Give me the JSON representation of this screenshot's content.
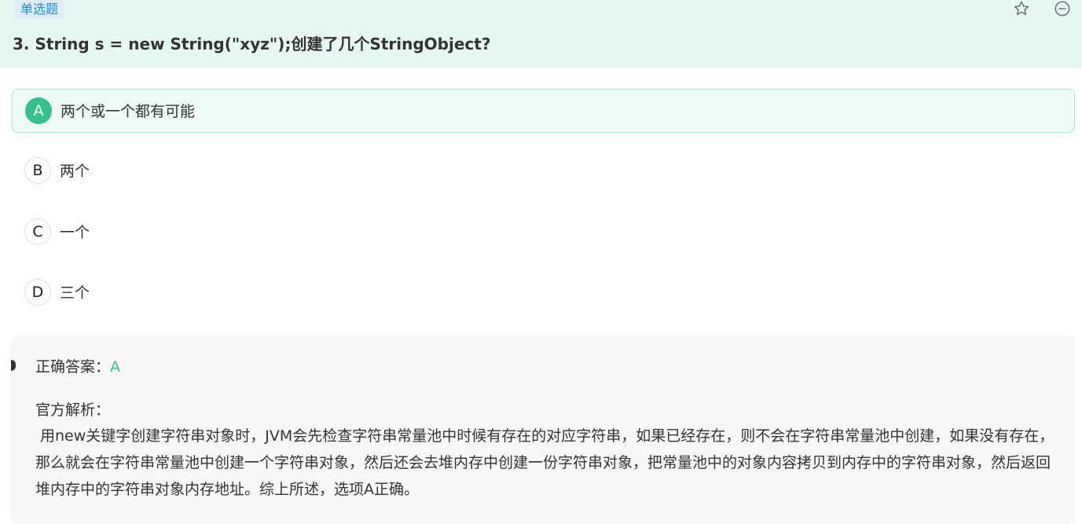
{
  "question": {
    "type_label": "单选题",
    "title": "3. String s = new String(\"xyz\");创建了几个StringObject?"
  },
  "toolbar": {
    "favorite_icon": "star-icon",
    "remove_icon": "minus-circle-icon"
  },
  "options": [
    {
      "letter": "A",
      "text": "两个或一个都有可能",
      "selected": true
    },
    {
      "letter": "B",
      "text": "两个",
      "selected": false
    },
    {
      "letter": "C",
      "text": "一个",
      "selected": false
    },
    {
      "letter": "D",
      "text": "三个",
      "selected": false
    }
  ],
  "analysis": {
    "answer_label": "正确答案：",
    "answer_value": "A",
    "official_label": "官方解析：",
    "text": "用new关键字创建字符串对象时，JVM会先检查字符串常量池中时候有存在的对应字符串，如果已经存在，则不会在字符串常量池中创建，如果没有存在，那么就会在字符串常量池中创建一个字符串对象，然后还会去堆内存中创建一份字符串对象，把常量池中的对象内容拷贝到内存中的字符串对象，然后返回堆内存中的字符串对象内存地址。综上所述，选项A正确。"
  },
  "colors": {
    "header_bg": "#e6f6f2",
    "accent_green": "#35c08d",
    "tag_blue": "#1a8fe0",
    "analysis_bg": "#f7f7f7"
  }
}
